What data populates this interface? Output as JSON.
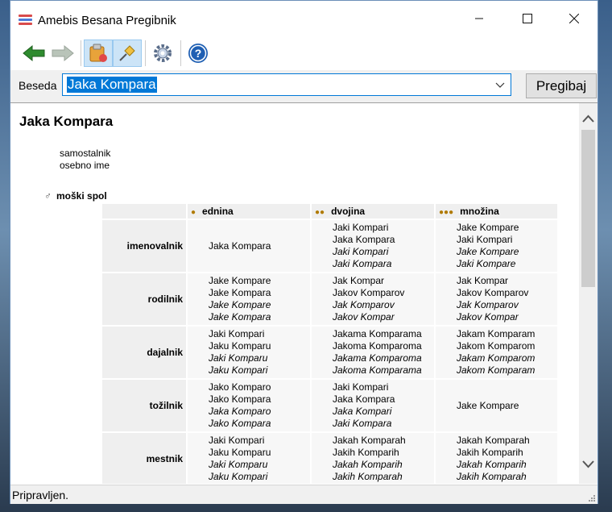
{
  "window": {
    "title": "Amebis Besana Pregibnik"
  },
  "search": {
    "label": "Beseda",
    "value": "Jaka Kompara",
    "button": "Pregibaj"
  },
  "entry": {
    "headword": "Jaka Kompara",
    "pos_lines": [
      "samostalnik",
      "osebno ime"
    ],
    "gender": "moški spol"
  },
  "table": {
    "headers": [
      "ednina",
      "dvojina",
      "množina"
    ],
    "rows": [
      {
        "case": "imenovalnik",
        "cells": [
          [
            [
              "Jaka Kompara",
              false
            ]
          ],
          [
            [
              "Jaki Kompari",
              false
            ],
            [
              "Jaka Kompara",
              false
            ],
            [
              "Jaki Kompari",
              true
            ],
            [
              "Jaki Kompara",
              true
            ]
          ],
          [
            [
              "Jake Kompare",
              false
            ],
            [
              "Jaki Kompari",
              false
            ],
            [
              "Jake Kompare",
              true
            ],
            [
              "Jaki Kompare",
              true
            ]
          ]
        ]
      },
      {
        "case": "rodilnik",
        "cells": [
          [
            [
              "Jake Kompare",
              false
            ],
            [
              "Jake Kompara",
              false
            ],
            [
              "Jake Kompare",
              true
            ],
            [
              "Jake Kompara",
              true
            ]
          ],
          [
            [
              "Jak Kompar",
              false
            ],
            [
              "Jakov Komparov",
              false
            ],
            [
              "Jak Komparov",
              true
            ],
            [
              "Jakov Kompar",
              true
            ]
          ],
          [
            [
              "Jak Kompar",
              false
            ],
            [
              "Jakov Komparov",
              false
            ],
            [
              "Jak Komparov",
              true
            ],
            [
              "Jakov Kompar",
              true
            ]
          ]
        ]
      },
      {
        "case": "dajalnik",
        "cells": [
          [
            [
              "Jaki Kompari",
              false
            ],
            [
              "Jaku Komparu",
              false
            ],
            [
              "Jaki Komparu",
              true
            ],
            [
              "Jaku Kompari",
              true
            ]
          ],
          [
            [
              "Jakama Komparama",
              false
            ],
            [
              "Jakoma Komparoma",
              false
            ],
            [
              "Jakama Komparoma",
              true
            ],
            [
              "Jakoma Komparama",
              true
            ]
          ],
          [
            [
              "Jakam Komparam",
              false
            ],
            [
              "Jakom Komparom",
              false
            ],
            [
              "Jakam Komparom",
              true
            ],
            [
              "Jakom Komparam",
              true
            ]
          ]
        ]
      },
      {
        "case": "tožilnik",
        "cells": [
          [
            [
              "Jako Komparo",
              false
            ],
            [
              "Jako Kompara",
              false
            ],
            [
              "Jaka Komparo",
              true
            ],
            [
              "Jako Kompara",
              true
            ]
          ],
          [
            [
              "Jaki Kompari",
              false
            ],
            [
              "Jaka Kompara",
              false
            ],
            [
              "Jaka Kompari",
              true
            ],
            [
              "Jaki Kompara",
              true
            ]
          ],
          [
            [
              "Jake Kompare",
              false
            ]
          ]
        ]
      },
      {
        "case": "mestnik",
        "cells": [
          [
            [
              "Jaki Kompari",
              false
            ],
            [
              "Jaku Komparu",
              false
            ],
            [
              "Jaki Komparu",
              true
            ],
            [
              "Jaku Kompari",
              true
            ]
          ],
          [
            [
              "Jakah Komparah",
              false
            ],
            [
              "Jakih Komparih",
              false
            ],
            [
              "Jakah Komparih",
              true
            ],
            [
              "Jakih Komparah",
              true
            ]
          ],
          [
            [
              "Jakah Komparah",
              false
            ],
            [
              "Jakih Komparih",
              false
            ],
            [
              "Jakah Komparih",
              true
            ],
            [
              "Jakih Komparah",
              true
            ]
          ]
        ]
      }
    ]
  },
  "status": {
    "text": "Pripravljen."
  },
  "colors": {
    "accent": "#0078d7",
    "back_arrow": "#2e8b2e"
  }
}
